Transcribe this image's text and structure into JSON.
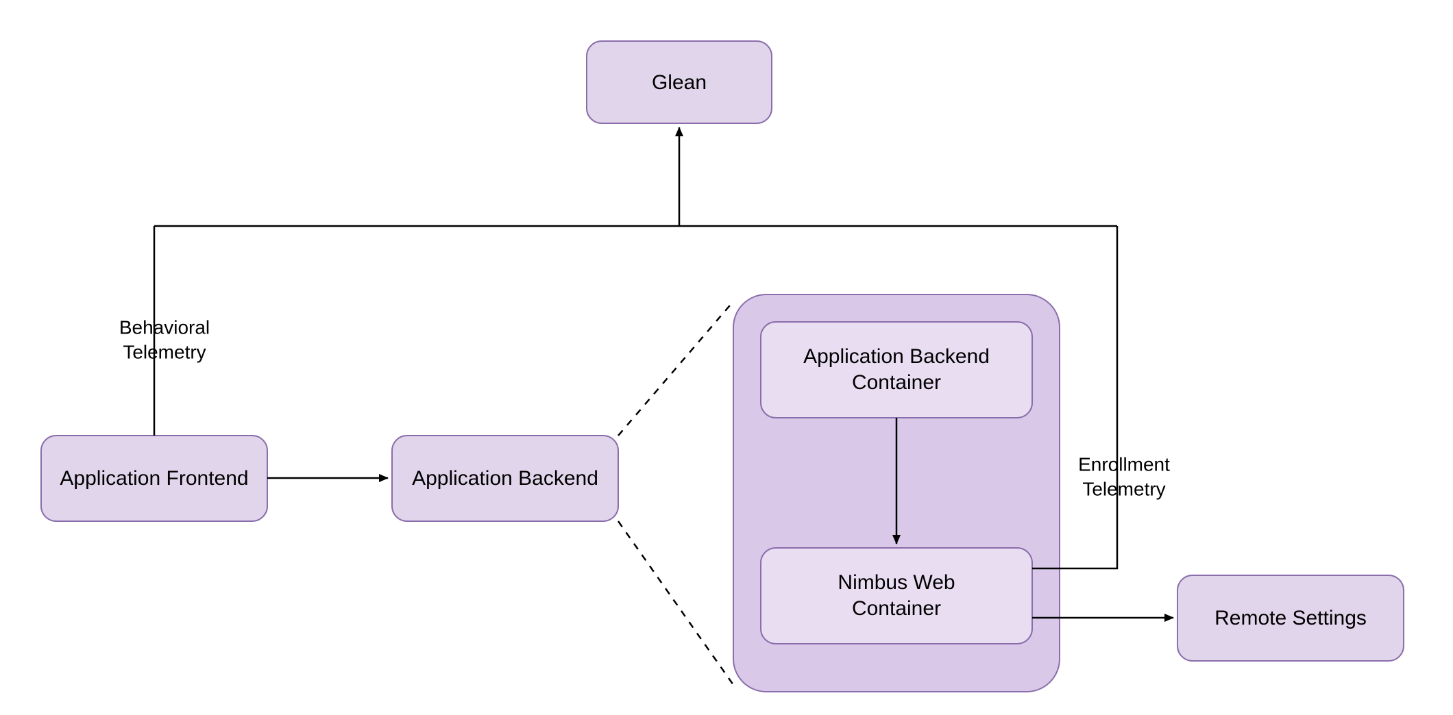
{
  "nodes": {
    "glean": {
      "label": "Glean"
    },
    "frontend": {
      "label": "Application Frontend"
    },
    "backend": {
      "label": "Application Backend"
    },
    "backend_container": {
      "line1": "Application Backend",
      "line2": "Container"
    },
    "nimbus_container": {
      "line1": "Nimbus Web",
      "line2": "Container"
    },
    "remote_settings": {
      "label": "Remote Settings"
    }
  },
  "edges": {
    "behavioral": {
      "line1": "Behavioral",
      "line2": "Telemetry"
    },
    "enrollment": {
      "line1": "Enrollment",
      "line2": "Telemetry"
    }
  }
}
